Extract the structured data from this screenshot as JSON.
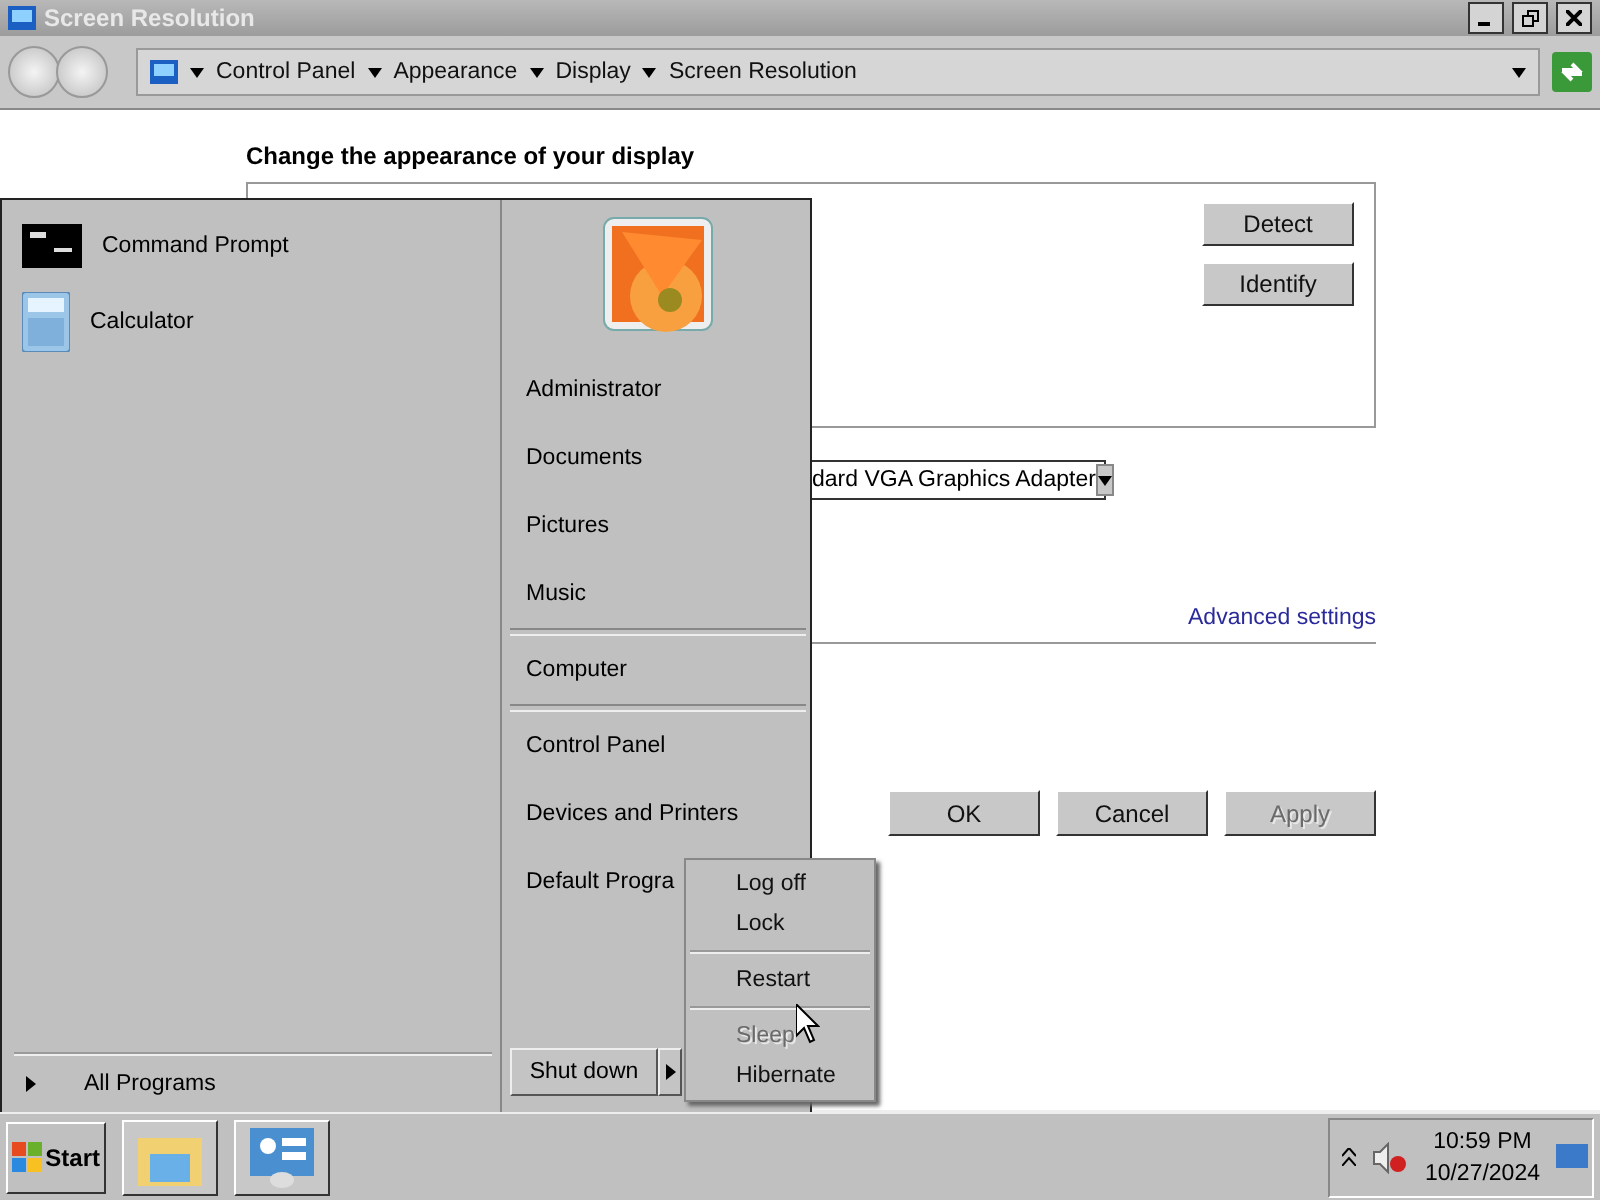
{
  "window": {
    "title": "Screen Resolution"
  },
  "address": {
    "crumbs": [
      "Control Panel",
      "Appearance",
      "Display",
      "Screen Resolution"
    ]
  },
  "page": {
    "heading": "Change the appearance of your display",
    "monitor_buttons": [
      "Detect",
      "Identify"
    ],
    "adapter_select": {
      "value": "dard VGA Graphics Adapter"
    },
    "advanced_link": "Advanced settings",
    "dialog_buttons": [
      {
        "label": "OK",
        "disabled": false
      },
      {
        "label": "Cancel",
        "disabled": false
      },
      {
        "label": "Apply",
        "disabled": true
      }
    ]
  },
  "start_menu": {
    "pinned": [
      {
        "label": "Command Prompt",
        "kind": "cmd"
      },
      {
        "label": "Calculator",
        "kind": "calc"
      }
    ],
    "all_programs": "All Programs",
    "right_groups": [
      [
        "Administrator",
        "Documents",
        "Pictures",
        "Music"
      ],
      [
        "Computer"
      ],
      [
        "Control Panel",
        "Devices and Printers",
        "Default Progra"
      ]
    ],
    "shutdown": "Shut down",
    "power_menu": [
      [
        {
          "label": "Log off",
          "disabled": false
        },
        {
          "label": "Lock",
          "disabled": false
        }
      ],
      [
        {
          "label": "Restart",
          "disabled": false
        }
      ],
      [
        {
          "label": "Sleep",
          "disabled": true
        },
        {
          "label": "Hibernate",
          "disabled": false
        }
      ]
    ]
  },
  "taskbar": {
    "start": "Start",
    "time": "10:59 PM",
    "date": "10/27/2024"
  }
}
